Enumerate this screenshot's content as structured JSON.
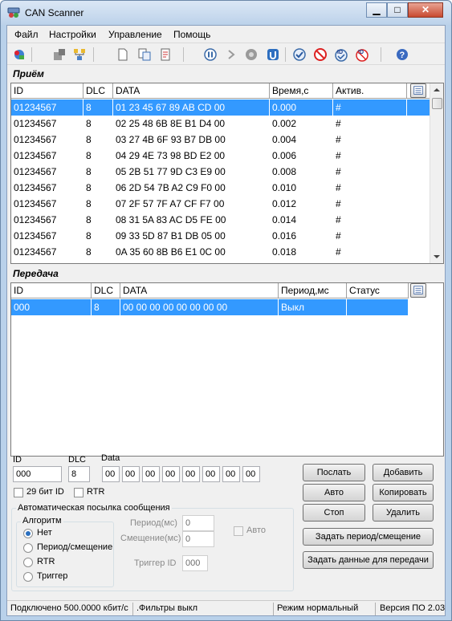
{
  "window": {
    "title": "CAN Scanner",
    "minimize": "▁",
    "maximize": "□",
    "close": "✕"
  },
  "menu": [
    "Файл",
    "Настройки",
    "Управление",
    "Помощь"
  ],
  "toolbar_icons": [
    "connect-icon",
    "disconnect-icon",
    "network-icon",
    "new-file-icon",
    "copy-icon",
    "edit-icon",
    "pause-icon",
    "play-icon",
    "stop-icon",
    "step-icon",
    "check-icon",
    "block-icon",
    "id-filter-icon",
    "id-block-icon",
    "help-icon"
  ],
  "receive": {
    "title": "Приём",
    "columns": [
      "ID",
      "DLC",
      "DATA",
      "Время,с",
      "Актив."
    ],
    "rows": [
      {
        "id": "01234567",
        "dlc": "8",
        "data": "01 23 45 67 89 AB CD 00",
        "time": "0.000",
        "active": "#"
      },
      {
        "id": "01234567",
        "dlc": "8",
        "data": "02 25 48 6B 8E B1 D4 00",
        "time": "0.002",
        "active": "#"
      },
      {
        "id": "01234567",
        "dlc": "8",
        "data": "03 27 4B 6F 93 B7 DB 00",
        "time": "0.004",
        "active": "#"
      },
      {
        "id": "01234567",
        "dlc": "8",
        "data": "04 29 4E 73 98 BD E2 00",
        "time": "0.006",
        "active": "#"
      },
      {
        "id": "01234567",
        "dlc": "8",
        "data": "05 2B 51 77 9D C3 E9 00",
        "time": "0.008",
        "active": "#"
      },
      {
        "id": "01234567",
        "dlc": "8",
        "data": "06 2D 54 7B A2 C9 F0 00",
        "time": "0.010",
        "active": "#"
      },
      {
        "id": "01234567",
        "dlc": "8",
        "data": "07 2F 57 7F A7 CF F7 00",
        "time": "0.012",
        "active": "#"
      },
      {
        "id": "01234567",
        "dlc": "8",
        "data": "08 31 5A 83 AC D5 FE 00",
        "time": "0.014",
        "active": "#"
      },
      {
        "id": "01234567",
        "dlc": "8",
        "data": "09 33 5D 87 B1 DB 05 00",
        "time": "0.016",
        "active": "#"
      },
      {
        "id": "01234567",
        "dlc": "8",
        "data": "0A 35 60 8B B6 E1 0C 00",
        "time": "0.018",
        "active": "#"
      }
    ]
  },
  "transmit": {
    "title": "Передача",
    "columns": [
      "ID",
      "DLC",
      "DATA",
      "Период,мс",
      "Статус"
    ],
    "rows": [
      {
        "id": "000",
        "dlc": "8",
        "data": "00 00 00 00 00 00 00 00",
        "period": "Выкл",
        "status": ""
      }
    ]
  },
  "form": {
    "id_label": "ID",
    "dlc_label": "DLC",
    "data_label": "Data",
    "id_value": "000",
    "dlc_value": "8",
    "data_bytes": [
      "00",
      "00",
      "00",
      "00",
      "00",
      "00",
      "00",
      "00"
    ],
    "bit29_label": "29 бит ID",
    "rtr_label": "RTR",
    "auto_group": "Автоматическая посылка сообщения",
    "algorithm_label": "Алгоритм",
    "algorithms": [
      "Нет",
      "Период/смещение",
      "RTR",
      "Триггер"
    ],
    "period_label": "Период(мс)",
    "period_value": "0",
    "offset_label": "Смещение(мс)",
    "offset_value": "0",
    "auto_label": "Авто",
    "trigger_label": "Триггер ID",
    "trigger_value": "000"
  },
  "buttons": {
    "send": "Послать",
    "add": "Добавить",
    "auto": "Авто",
    "copy": "Копировать",
    "stop": "Стоп",
    "delete": "Удалить",
    "set_period": "Задать период/смещение",
    "set_data": "Задать данные для передачи"
  },
  "status": {
    "connection": "Подключено 500.0000 кбит/с",
    "filters": ".Фильтры выкл",
    "mode": "Режим нормальный",
    "version": "Версия ПО 2.03"
  }
}
